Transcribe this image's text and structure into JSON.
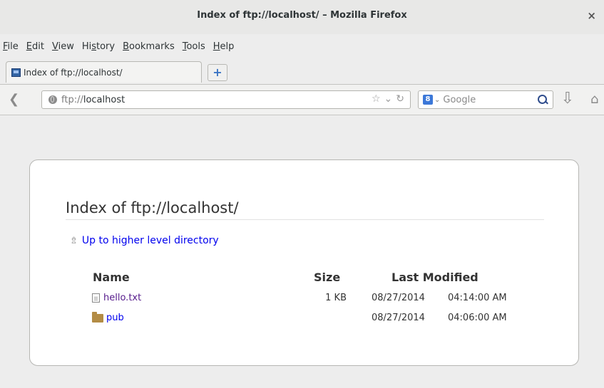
{
  "window": {
    "title": "Index of ftp://localhost/ – Mozilla Firefox",
    "close_glyph": "×"
  },
  "menu": {
    "items": [
      {
        "accel": "F",
        "rest": "ile"
      },
      {
        "accel": "E",
        "rest": "dit"
      },
      {
        "accel": "V",
        "rest": "iew"
      },
      {
        "pre": "Hi",
        "accel": "s",
        "rest": "tory"
      },
      {
        "accel": "B",
        "rest": "ookmarks"
      },
      {
        "accel": "T",
        "rest": "ools"
      },
      {
        "accel": "H",
        "rest": "elp"
      }
    ]
  },
  "tabs": [
    {
      "label": "Index of ftp://localhost/",
      "icon": "ftp-favicon-icon"
    }
  ],
  "navbar": {
    "url_scheme": "ftp://",
    "url_host": "localhost",
    "search_placeholder": "Google",
    "search_engine_glyph": "8"
  },
  "page": {
    "heading": "Index of ftp://localhost/",
    "up_link": "Up to higher level directory",
    "columns": {
      "name": "Name",
      "size": "Size",
      "modified": "Last Modified"
    },
    "rows": [
      {
        "name": "hello.txt",
        "type": "file",
        "size": "1 KB",
        "date": "08/27/2014",
        "time": "04:14:00 AM"
      },
      {
        "name": "pub",
        "type": "folder",
        "size": "",
        "date": "08/27/2014",
        "time": "04:06:00 AM"
      }
    ]
  },
  "colors": {
    "link": "#0000ee",
    "visited_link": "#551a8b",
    "background": "#ededed"
  }
}
